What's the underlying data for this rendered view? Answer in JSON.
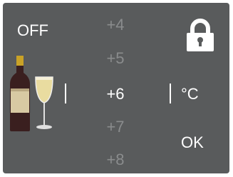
{
  "power": {
    "label": "OFF"
  },
  "lock": {
    "icon": "lock-icon",
    "state": "locked"
  },
  "wine": {
    "icon": "wine-bottle-and-glass-icon"
  },
  "temperature": {
    "options": [
      "+4",
      "+5",
      "+6",
      "+7",
      "+8"
    ],
    "selected": "+6",
    "unit": "°C"
  },
  "confirm": {
    "label": "OK"
  },
  "colors": {
    "background": "#595b5c",
    "active_text": "#ffffff",
    "inactive_text": "#8a8c8d"
  }
}
